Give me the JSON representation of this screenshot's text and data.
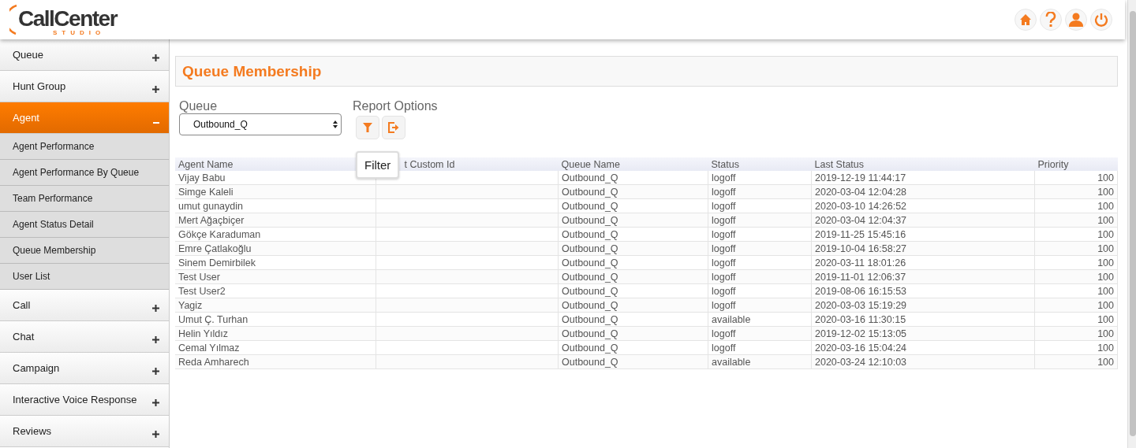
{
  "logo": {
    "name": "CallCenter",
    "tagline": "STUDIO"
  },
  "sidebar": {
    "items": [
      {
        "label": "Queue",
        "expanded": false
      },
      {
        "label": "Hunt Group",
        "expanded": false
      },
      {
        "label": "Agent",
        "expanded": true,
        "children": [
          {
            "label": "Agent Performance"
          },
          {
            "label": "Agent Performance By Queue"
          },
          {
            "label": "Team Performance"
          },
          {
            "label": "Agent Status Detail"
          },
          {
            "label": "Queue Membership"
          },
          {
            "label": "User List"
          }
        ]
      },
      {
        "label": "Call",
        "expanded": false
      },
      {
        "label": "Chat",
        "expanded": false
      },
      {
        "label": "Campaign",
        "expanded": false
      },
      {
        "label": "Interactive Voice Response",
        "expanded": false
      },
      {
        "label": "Reviews",
        "expanded": false
      }
    ]
  },
  "page_title": "Queue Membership",
  "queue": {
    "label": "Queue",
    "value": "Outbound_Q"
  },
  "report_options": {
    "label": "Report Options",
    "tooltip": "Filter"
  },
  "table": {
    "columns": [
      "Agent Name",
      "t Custom Id",
      "Queue Name",
      "Status",
      "Last Status",
      "Priority"
    ],
    "rows": [
      [
        "Vijay Babu",
        "",
        "Outbound_Q",
        "logoff",
        "2019-12-19 11:44:17",
        "100"
      ],
      [
        "Simge Kaleli",
        "",
        "Outbound_Q",
        "logoff",
        "2020-03-04 12:04:28",
        "100"
      ],
      [
        "umut gunaydin",
        "",
        "Outbound_Q",
        "logoff",
        "2020-03-10 14:26:52",
        "100"
      ],
      [
        "Mert Ağaçbiçer",
        "",
        "Outbound_Q",
        "logoff",
        "2020-03-04 12:04:37",
        "100"
      ],
      [
        "Gökçe Karaduman",
        "",
        "Outbound_Q",
        "logoff",
        "2019-11-25 15:45:16",
        "100"
      ],
      [
        "Emre Çatlakoğlu",
        "",
        "Outbound_Q",
        "logoff",
        "2019-10-04 16:58:27",
        "100"
      ],
      [
        "Sinem Demirbilek",
        "",
        "Outbound_Q",
        "logoff",
        "2020-03-11 18:01:26",
        "100"
      ],
      [
        "Test User",
        "",
        "Outbound_Q",
        "logoff",
        "2019-11-01 12:06:37",
        "100"
      ],
      [
        "Test User2",
        "",
        "Outbound_Q",
        "logoff",
        "2019-08-06 16:15:53",
        "100"
      ],
      [
        "Yagiz",
        "",
        "Outbound_Q",
        "logoff",
        "2020-03-03 15:19:29",
        "100"
      ],
      [
        "Umut Ç. Turhan",
        "",
        "Outbound_Q",
        "available",
        "2020-03-16 11:30:15",
        "100"
      ],
      [
        "Helin Yıldız",
        "",
        "Outbound_Q",
        "logoff",
        "2019-12-02 15:13:05",
        "100"
      ],
      [
        "Cemal Yılmaz",
        "",
        "Outbound_Q",
        "logoff",
        "2020-03-16 15:04:24",
        "100"
      ],
      [
        "Reda Amharech",
        "",
        "Outbound_Q",
        "available",
        "2020-03-24 12:10:03",
        "100"
      ]
    ]
  }
}
